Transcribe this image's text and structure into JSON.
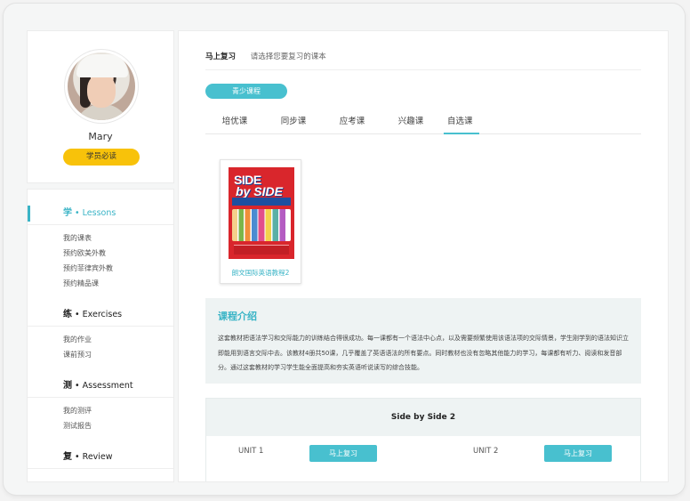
{
  "profile": {
    "name": "Mary",
    "student_button": "学员必读"
  },
  "menu": {
    "sections": [
      {
        "zh": "学",
        "en": " • Lessons",
        "items": [
          "我的课表",
          "预约欧美外教",
          "预约菲律宾外教",
          "预约精品课"
        ]
      },
      {
        "zh": "练",
        "en": " • Exercises",
        "items": [
          "我的作业",
          "课前预习"
        ]
      },
      {
        "zh": "测",
        "en": " • Assessment",
        "items": [
          "我的测评",
          "测试报告"
        ]
      },
      {
        "zh": "复",
        "en": " • Review",
        "items": []
      }
    ]
  },
  "main": {
    "title": "马上复习",
    "hint": "请选择您要复习的课本",
    "category_pill": "青少课程",
    "tabs": [
      "培优课",
      "同步课",
      "应考课",
      "兴趣课",
      "自选课"
    ],
    "active_tab": 4,
    "book": {
      "title": "朗文国际英语教程2"
    },
    "intro": {
      "heading": "课程介绍",
      "text": "这套教材把语法学习和交际能力的训练结合得很成功。每一课都有一个语法中心点，以及需要频繁使用该语法项的交际情景，学生刚学到的语法知识立即能用到语言交际中去。该教材4册共50课，几乎覆盖了英语语法的所有要点。同时教材也没有忽略其他能力的学习，每课都有听力、阅读和发音部分。通过这套教材的学习学生能全面提高和夯实英语听说读写的综合技能。"
    },
    "units": {
      "header": "Side by Side 2",
      "rows": [
        {
          "label": "UNIT 1",
          "button": "马上复习"
        },
        {
          "label": "UNIT 2",
          "button": "马上复习"
        }
      ]
    }
  }
}
